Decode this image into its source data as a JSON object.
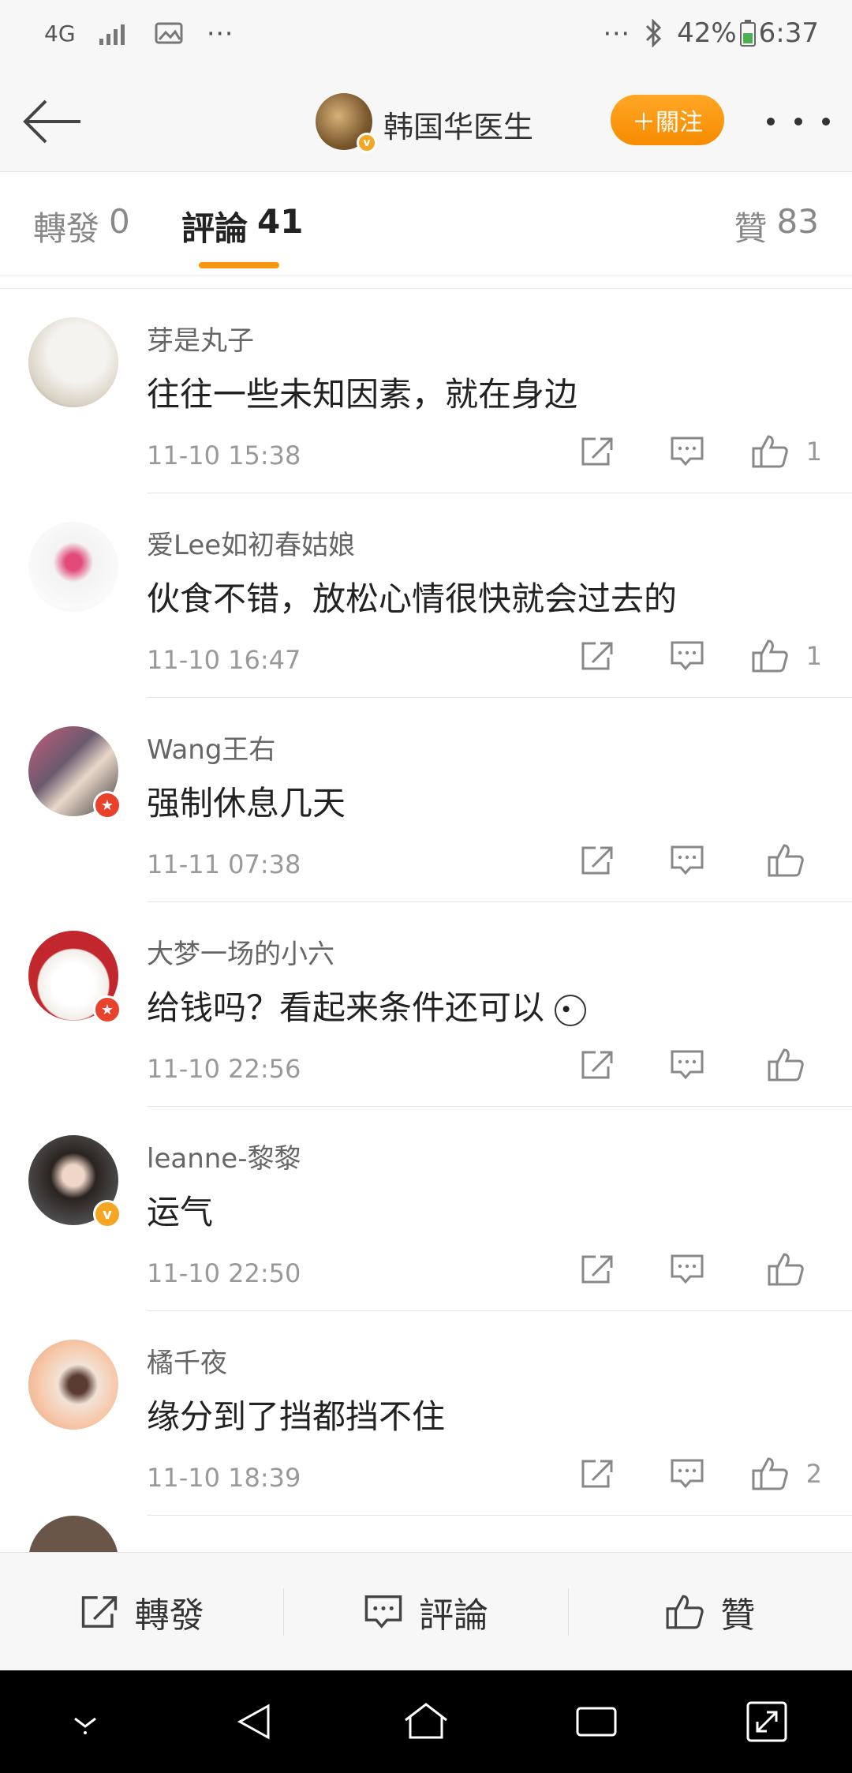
{
  "status_bar": {
    "network": "4G",
    "battery": "42%",
    "time": "6:37",
    "dots": "⋯"
  },
  "header": {
    "username": "韩国华医生",
    "follow_label": "＋關注"
  },
  "tabs": [
    {
      "label": "轉發",
      "count": "0"
    },
    {
      "label": "評論",
      "count": "41"
    },
    {
      "label": "贊",
      "count": "83"
    }
  ],
  "comments": [
    {
      "name": "芽是丸子",
      "text": "往往一些未知因素，就在身边",
      "time": "11-10 15:38",
      "likes": "1",
      "badge": ""
    },
    {
      "name": "爱Lee如初春姑娘",
      "text": "伙食不错，放松心情很快就会过去的",
      "time": "11-10 16:47",
      "likes": "1",
      "badge": ""
    },
    {
      "name": "Wang王右",
      "text": "强制休息几天",
      "time": "11-11 07:38",
      "likes": "",
      "badge": "red"
    },
    {
      "name": "大梦一场的小六",
      "text": "给钱吗？看起来条件还可以",
      "time": "11-10 22:56",
      "likes": "",
      "badge": "red"
    },
    {
      "name": "leanne-黎黎",
      "text": "运气",
      "time": "11-10 22:50",
      "likes": "",
      "badge": "gold"
    },
    {
      "name": "橘千夜",
      "text": "缘分到了挡都挡不住",
      "time": "11-10 18:39",
      "likes": "2",
      "badge": ""
    }
  ],
  "bottom_bar": {
    "repost": "轉發",
    "comment": "評論",
    "like": "贊"
  },
  "colors": {
    "accent": "#f7960c",
    "badge_red": "#e8412c",
    "badge_gold": "#f5a623"
  }
}
